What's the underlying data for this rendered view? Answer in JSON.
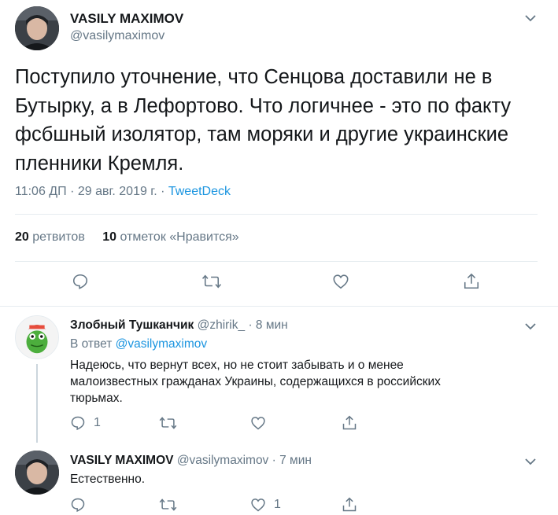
{
  "main_tweet": {
    "author_name": "VASILY MAXIMOV",
    "author_handle": "@vasilymaximov",
    "text_lines": [
      "Поступило уточнение, что Сенцова доставили не в",
      "Бутырку, а в Лефортово. Что логичнее - это по факту",
      "фсбшный изолятор, там моряки и другие украинские",
      "пленники Кремля."
    ],
    "timestamp": "11:06 ДП · 29 авг. 2019 г. · ",
    "source": "TweetDeck",
    "retweets_count": "20",
    "retweets_label": "ретвитов",
    "likes_count": "10",
    "likes_label": "отметок «Нравится»"
  },
  "reply1": {
    "author_name": "Злобный Тушканчик",
    "author_handle": "@zhirik_",
    "separator": "·",
    "time": "8 мин",
    "reply_to_prefix": "В ответ",
    "reply_to_handle": "@vasilymaximov",
    "text_lines": [
      "Надеюсь, что вернут всех, но не стоит забывать и о менее",
      "малоизвестных гражданах Украины, содержащихся в российских",
      "тюрьмах."
    ],
    "reply_count": "1",
    "retweet_count": "",
    "like_count": ""
  },
  "reply2": {
    "author_name": "VASILY MAXIMOV",
    "author_handle": "@vasilymaximov",
    "separator": "·",
    "time": "7 мин",
    "text": "Естественно.",
    "reply_count": "",
    "retweet_count": "",
    "like_count": "1"
  },
  "colors": {
    "accent": "#1b95e0",
    "muted": "#657786",
    "divider": "#e6ecf0"
  },
  "icons": [
    "reply-icon",
    "retweet-icon",
    "like-icon",
    "share-icon",
    "chevron-down-icon"
  ]
}
